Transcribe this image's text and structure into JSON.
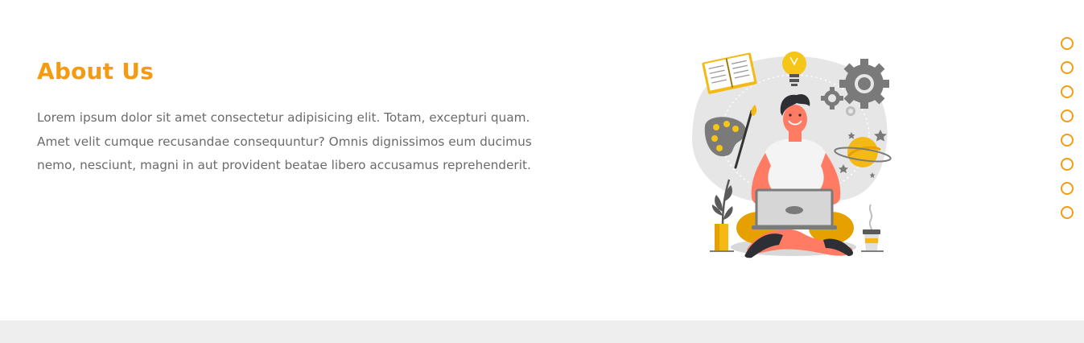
{
  "about": {
    "title": "About Us",
    "paragraph": "Lorem ipsum dolor sit amet consectetur adipisicing elit. Totam, excepturi quam. Amet velit cumque recusandae consequuntur? Omnis dignissimos eum ducimus nemo, nesciunt, magni in aut provident beatae libero accusamus reprehenderit."
  },
  "illustration": {
    "icon": "person-with-laptop-illustration",
    "elements": [
      "book-icon",
      "lightbulb-icon",
      "gear-icon",
      "palette-icon",
      "planet-icon",
      "plant-icon",
      "coffee-cup-icon",
      "laptop-icon"
    ]
  },
  "dot_nav": {
    "count": 8,
    "icon": "circle-outline-icon"
  },
  "colors": {
    "accent": "#f39c12",
    "text": "#6b6b6b",
    "background": "#ffffff",
    "footer": "#eeeeee",
    "illustration_gray": "#e6e6e6",
    "skin_orange": "#ff7b63"
  }
}
